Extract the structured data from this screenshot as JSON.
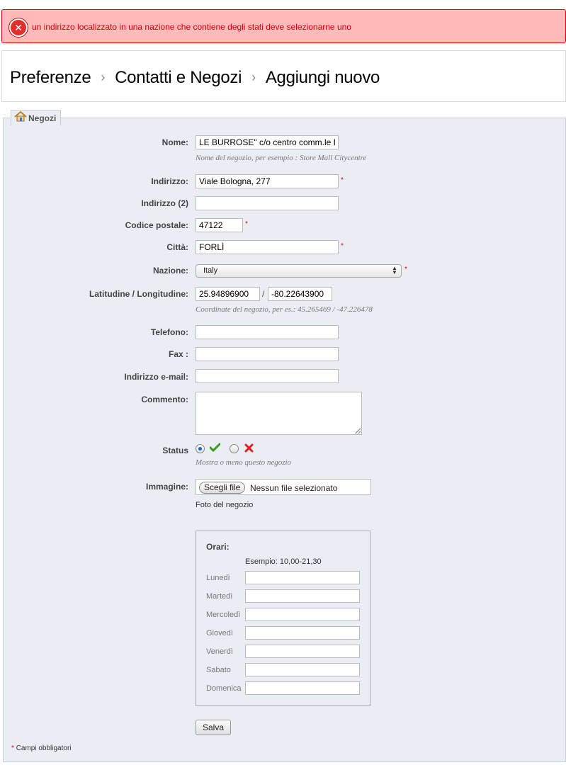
{
  "error": {
    "message": "un indirizzo localizzato in una nazione che contiene degli stati deve selezionarne uno"
  },
  "breadcrumb": {
    "items": [
      "Preferenze",
      "Contatti e Negozi",
      "Aggiungi nuovo"
    ],
    "separator": "›"
  },
  "fieldset": {
    "legend": "Negozi"
  },
  "form": {
    "nome": {
      "label": "Nome:",
      "value": "LE BURROSE\" c/o centro comm.le I",
      "hint": "Nome del negozio, per esempio : Store Mall Citycentre"
    },
    "indirizzo": {
      "label": "Indirizzo:",
      "value": "Viale Bologna, 277"
    },
    "indirizzo2": {
      "label": "Indirizzo (2)",
      "value": ""
    },
    "cap": {
      "label": "Codice postale:",
      "value": "47122"
    },
    "citta": {
      "label": "Città:",
      "value": "FORLÌ"
    },
    "nazione": {
      "label": "Nazione:",
      "value": "Italy"
    },
    "latlng": {
      "label": "Latitudine / Longitudine:",
      "lat": "25.94896900",
      "sep": "/",
      "lng": "-80.22643900",
      "hint": "Coordinate del negozio, per es.: 45.265469 / -47.226478"
    },
    "telefono": {
      "label": "Telefono:",
      "value": ""
    },
    "fax": {
      "label": "Fax :",
      "value": ""
    },
    "email": {
      "label": "Indirizzo e-mail:",
      "value": ""
    },
    "commento": {
      "label": "Commento:",
      "value": ""
    },
    "status": {
      "label": "Status",
      "hint": "Mostra o meno questo negozio"
    },
    "immagine": {
      "label": "Immagine:",
      "button": "Scegli file",
      "text": "Nessun file selezionato",
      "hint": "Foto del negozio"
    },
    "required_mark": "*"
  },
  "hours": {
    "title": "Orari:",
    "example": "Esempio: 10,00-21,30",
    "days": [
      "Lunedì",
      "Martedì",
      "Mercoledì",
      "Giovedì",
      "Venerdì",
      "Sabato",
      "Domenica"
    ]
  },
  "save_button": "Salva",
  "footnote": {
    "star": "*",
    "text": "Campi obbligatori"
  },
  "colors": {
    "error_bg": "#ffbaba",
    "error_text": "#d8000c",
    "panel_bg": "#ebedf4",
    "check_green": "#3a9a1a",
    "cross_red": "#e02020"
  }
}
